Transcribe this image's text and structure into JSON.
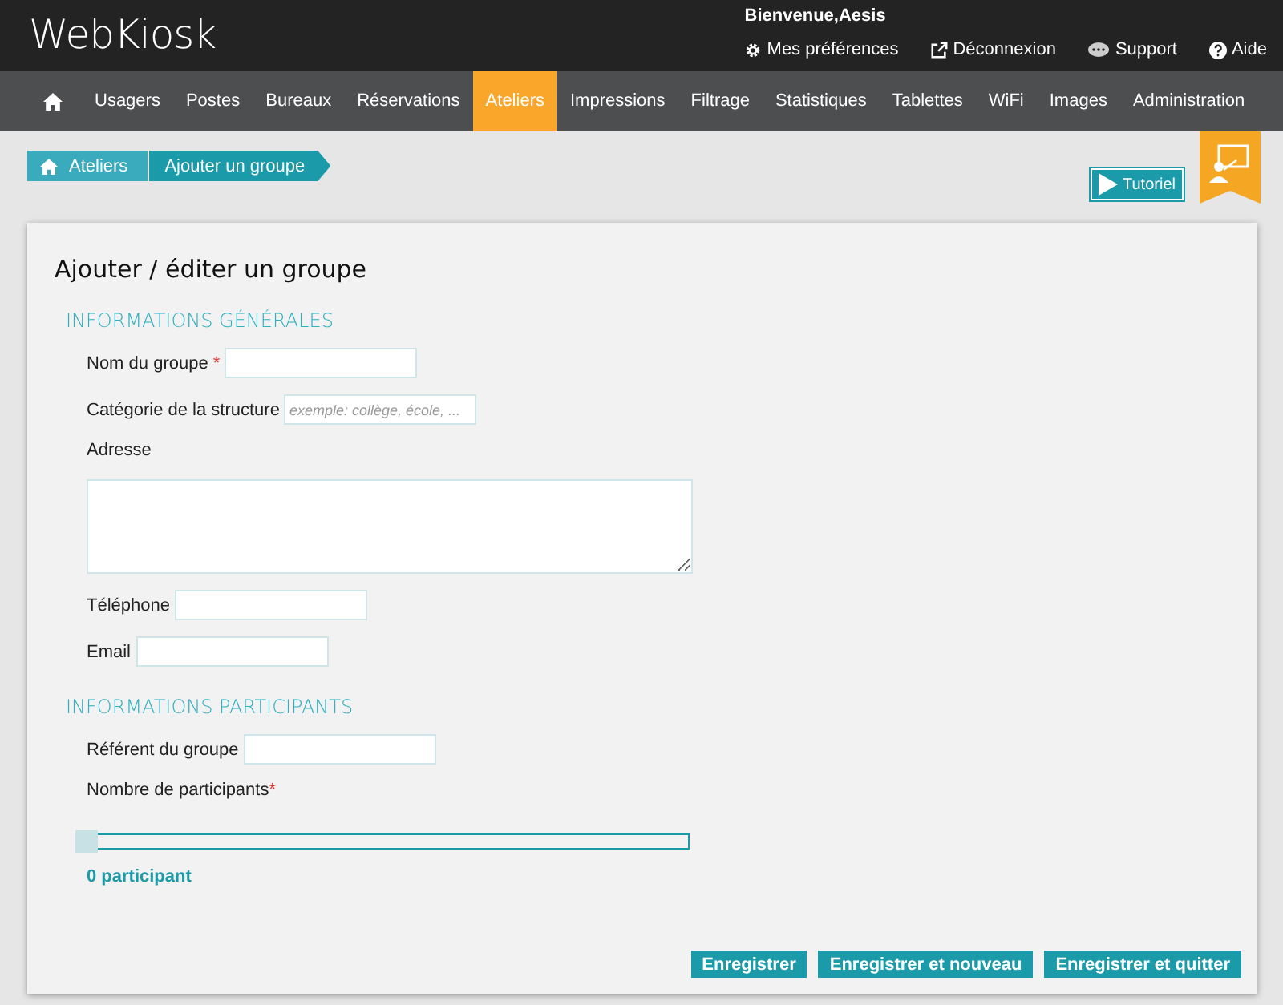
{
  "logo": "WebKiosk",
  "welcome": "Bienvenue,Aesis",
  "user_links": [
    {
      "label": "Mes préférences",
      "kind": "gear"
    },
    {
      "label": "Déconnexion",
      "kind": "external"
    },
    {
      "label": "Support",
      "kind": "chat"
    },
    {
      "label": "Aide",
      "kind": "help"
    }
  ],
  "nav": [
    {
      "label": "Usagers",
      "selected": false
    },
    {
      "label": "Postes",
      "selected": false
    },
    {
      "label": "Bureaux",
      "selected": false
    },
    {
      "label": "Réservations",
      "selected": false
    },
    {
      "label": "Ateliers",
      "selected": true
    },
    {
      "label": "Impressions",
      "selected": false
    },
    {
      "label": "Filtrage",
      "selected": false
    },
    {
      "label": "Statistiques",
      "selected": false
    },
    {
      "label": "Tablettes",
      "selected": false
    },
    {
      "label": "WiFi",
      "selected": false
    },
    {
      "label": "Images",
      "selected": false
    },
    {
      "label": "Administration",
      "selected": false
    }
  ],
  "breadcrumb": [
    "Ateliers",
    "Ajouter un groupe"
  ],
  "tutorial_button": "Tutoriel",
  "title": "Ajouter / éditer un groupe",
  "sections": [
    {
      "heading": "INFORMATIONS GÉNÉRALES",
      "fields": [
        {
          "kind": "input",
          "label": "Nom du groupe",
          "required_mark": "*"
        },
        {
          "kind": "input",
          "label": "Catégorie de la structure",
          "placeholder": "exemple: collège, école, ..."
        },
        {
          "kind": "textarea",
          "label": "Adresse"
        },
        {
          "kind": "input",
          "label": "Téléphone"
        },
        {
          "kind": "input",
          "label": "Email"
        }
      ]
    },
    {
      "heading": "INFORMATIONS PARTICIPANTS",
      "fields": [
        {
          "kind": "input",
          "label": "Référent du groupe"
        },
        {
          "kind": "slider",
          "label": "Nombre de participants",
          "required_mark": "*",
          "level": 0,
          "reading": "0 participant"
        }
      ]
    }
  ],
  "buttons": [
    "Enregistrer",
    "Enregistrer et nouveau",
    "Enregistrer et quitter"
  ]
}
